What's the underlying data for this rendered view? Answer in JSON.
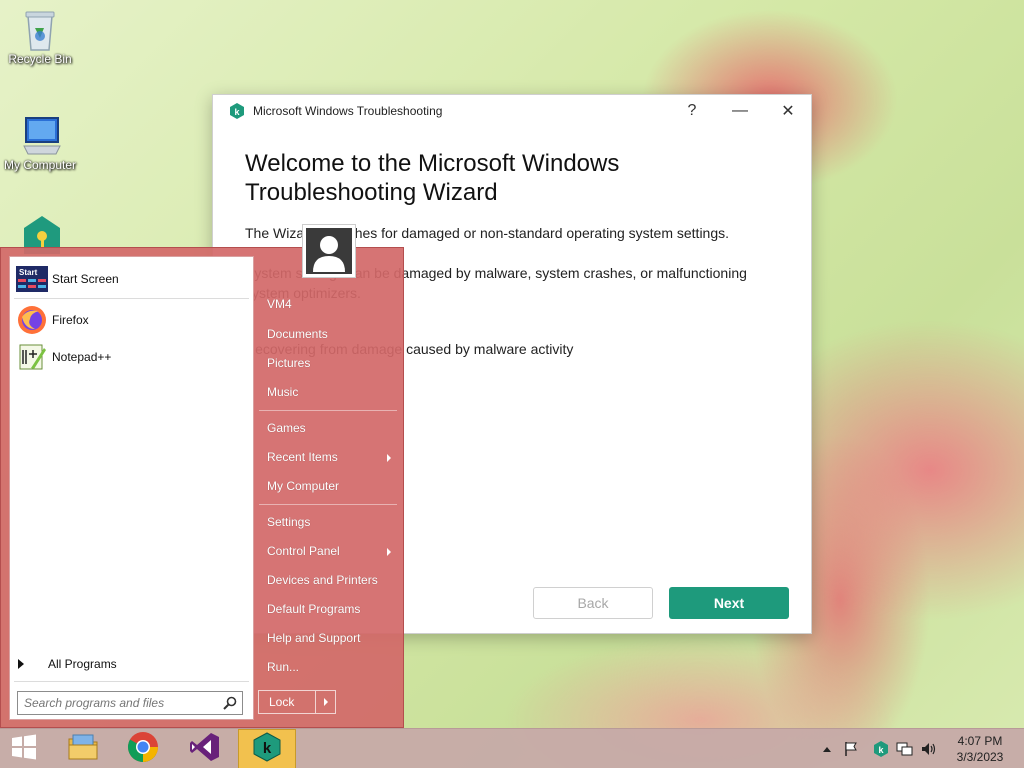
{
  "desktop": {
    "icons": [
      {
        "label": "Recycle Bin",
        "icon": "recycle-bin-icon"
      },
      {
        "label": "My Computer",
        "icon": "computer-icon"
      },
      {
        "label": "",
        "icon": "kaspersky-shield-icon"
      }
    ]
  },
  "wizard": {
    "title": "Microsoft Windows Troubleshooting",
    "help_glyph": "?",
    "minimize_glyph": "—",
    "close_glyph": "✕",
    "heading": "Welcome to the Microsoft Windows Troubleshooting Wizard",
    "line1": "The Wizard searches for damaged or non-standard operating system settings.",
    "line2": "System settings can be damaged by malware, system crashes, or malfunctioning system optimizers.",
    "line3": "Recovering from damage caused by malware activity",
    "back_label": "Back",
    "next_label": "Next",
    "accent": "#1e9a7c"
  },
  "start_menu": {
    "pinned": [
      {
        "label": "Start Screen",
        "icon": "start-screen-icon"
      },
      {
        "label": "Firefox",
        "icon": "firefox-icon"
      },
      {
        "label": "Notepad++",
        "icon": "notepadpp-icon"
      }
    ],
    "all_programs": "All Programs",
    "search_placeholder": "Search programs and files",
    "right_items": [
      {
        "label": "VM4"
      },
      {
        "label": "Documents"
      },
      {
        "label": "Pictures"
      },
      {
        "label": "Music"
      },
      {
        "label": "Games"
      },
      {
        "label": "Recent Items",
        "submenu": true
      },
      {
        "label": "My Computer"
      },
      {
        "label": "Settings"
      },
      {
        "label": "Control Panel",
        "submenu": true
      },
      {
        "label": "Devices and Printers"
      },
      {
        "label": "Default Programs"
      },
      {
        "label": "Help and Support"
      },
      {
        "label": "Run..."
      }
    ],
    "lock_label": "Lock",
    "background_color": "#d26868"
  },
  "taskbar": {
    "apps": [
      "start-button",
      "file-explorer-icon",
      "chrome-icon",
      "visual-studio-icon",
      "kaspersky-icon"
    ],
    "tray_icons": [
      "show-hidden-icon",
      "action-center-flag-icon",
      "kaspersky-tray-icon",
      "network-icon",
      "volume-icon"
    ],
    "clock_time": "4:07 PM",
    "clock_date": "3/3/2023"
  }
}
